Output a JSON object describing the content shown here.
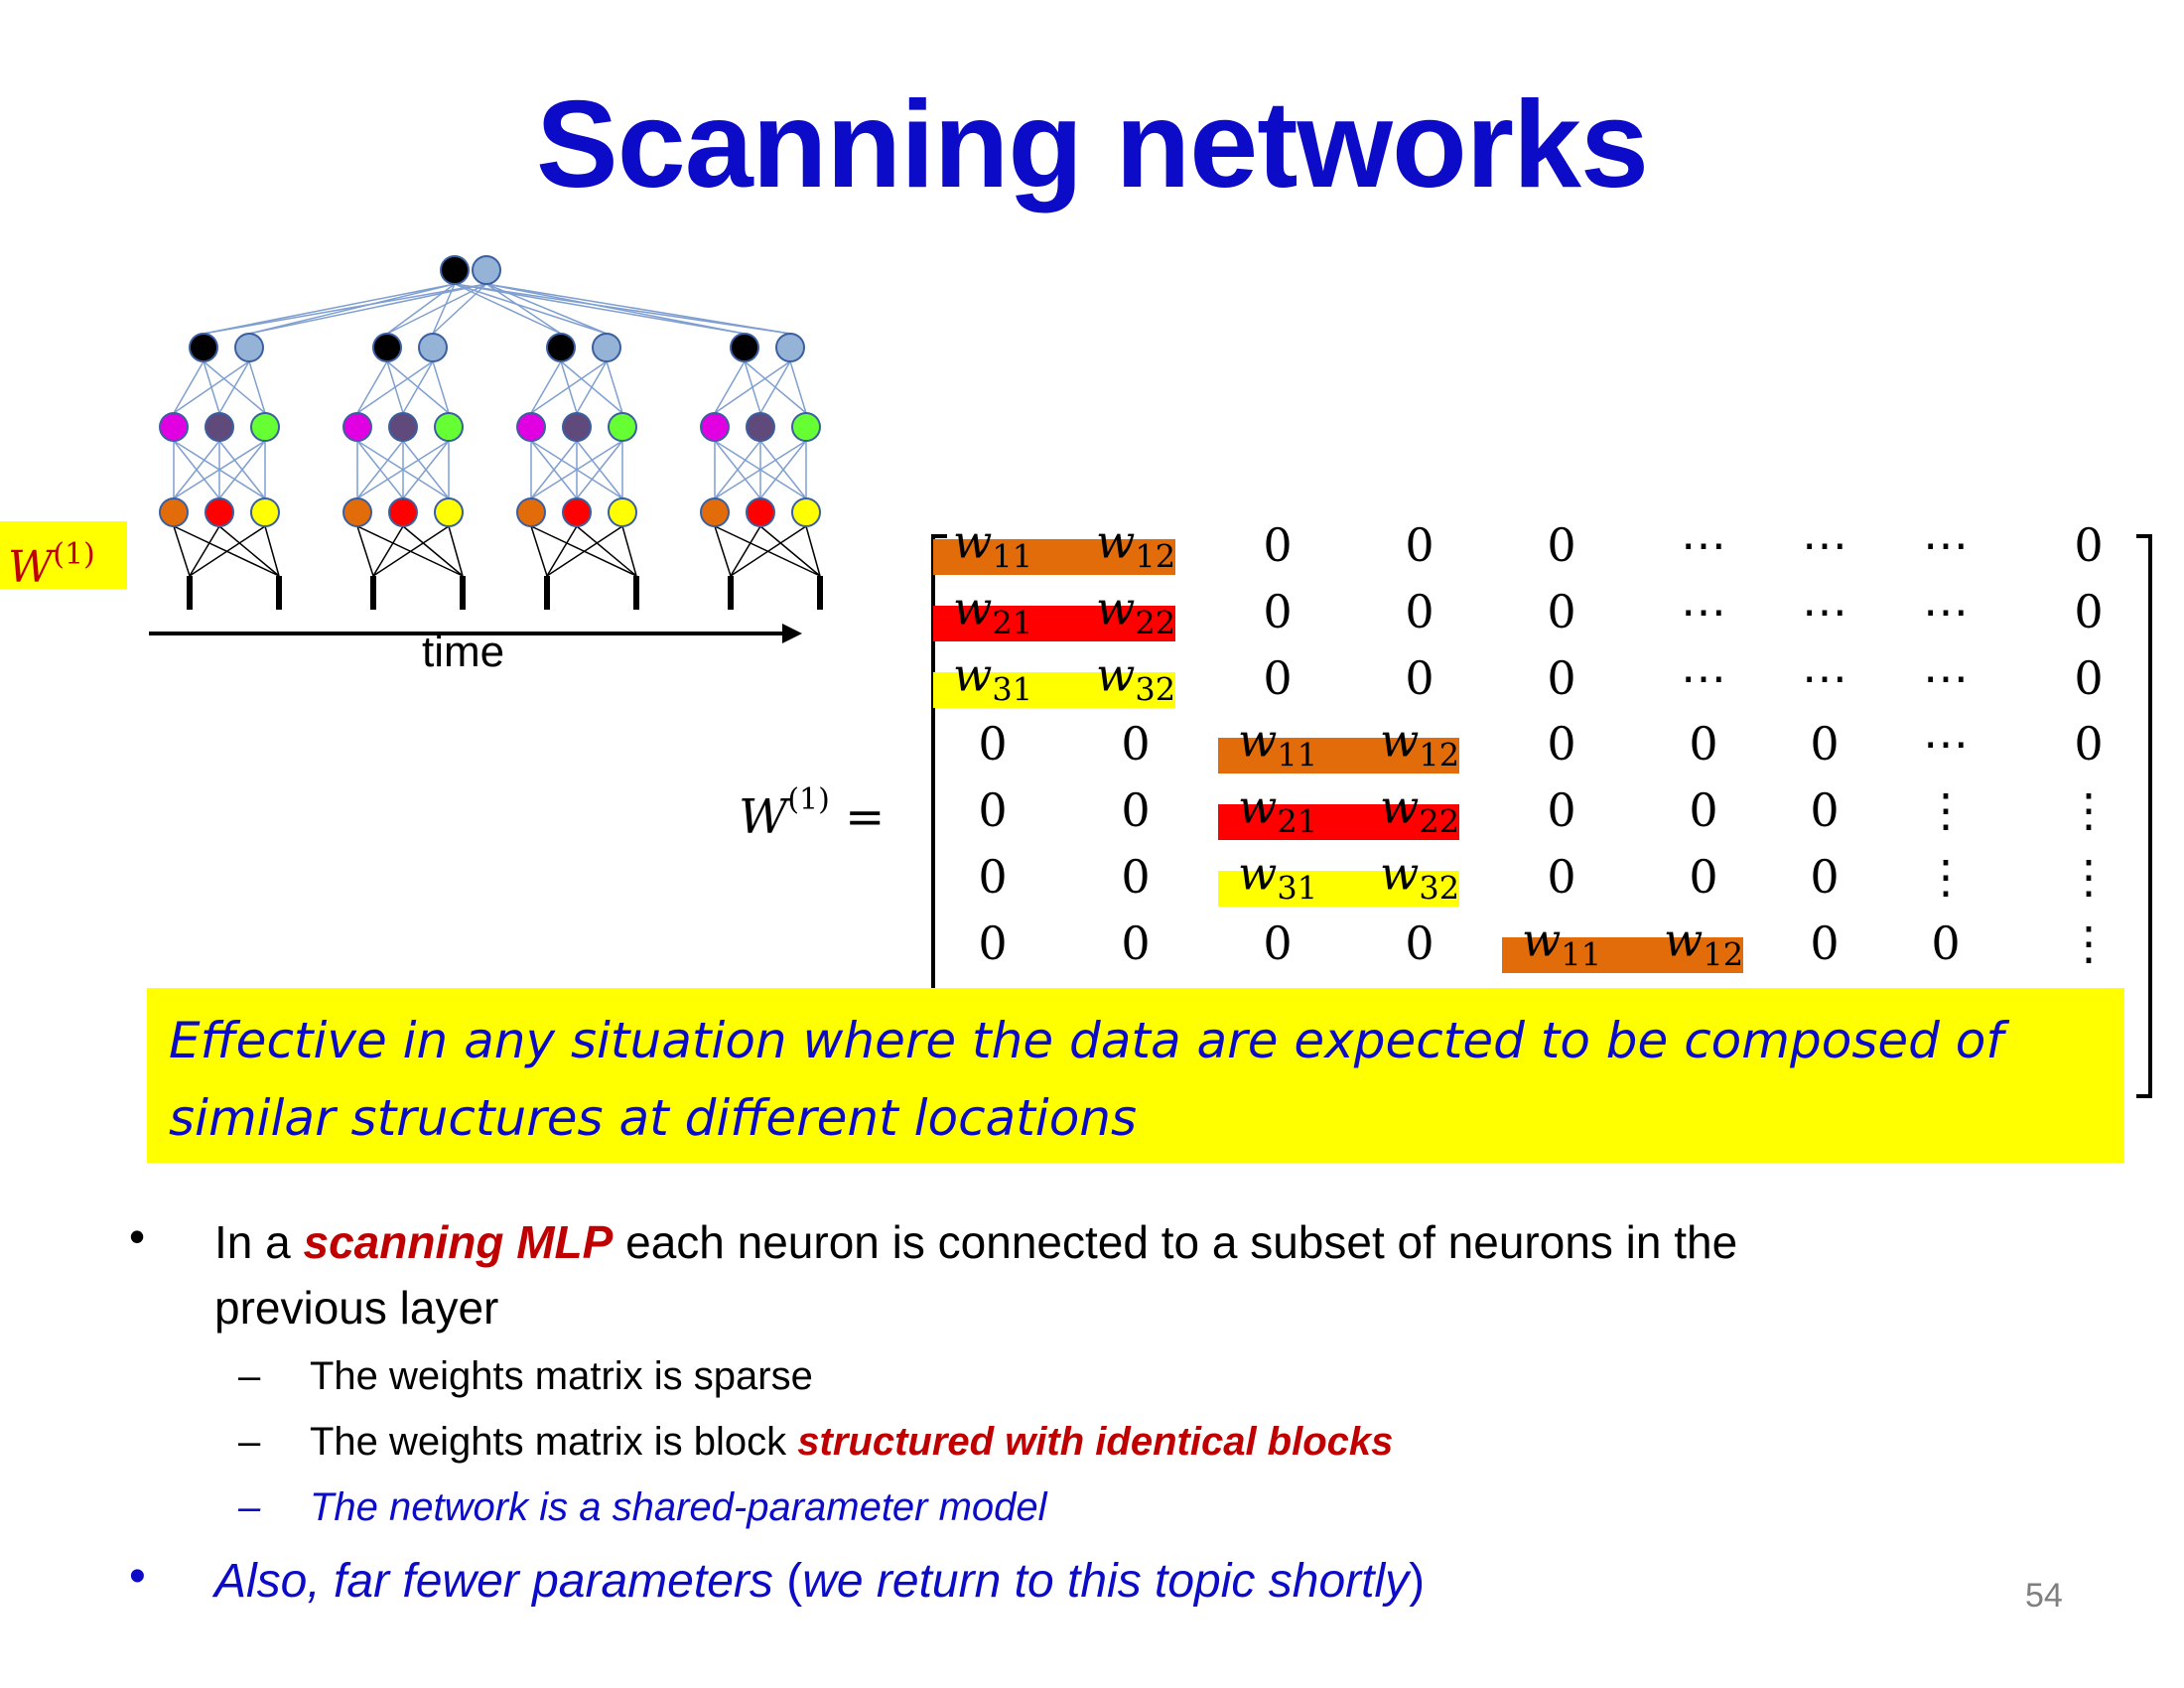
{
  "slide": {
    "title": "Scanning networks",
    "w_label_base": "W",
    "w_label_sup": "(1)",
    "time_label": "time",
    "matrix_lhs_base": "W",
    "matrix_lhs_sup": "(1)",
    "matrix_lhs_eq": "=",
    "callout_line1": "Effective in any situation where the data are expected to be composed of",
    "callout_line2": "similar structures at different locations",
    "bullet1_pre": "In a ",
    "bullet1_em": "scanning MLP",
    "bullet1_post": " each neuron is connected to a subset of neurons in the",
    "bullet1_line2": "previous layer",
    "sub1": "The weights matrix is sparse",
    "sub2_pre": "The weights matrix is block ",
    "sub2_em": "structured with identical blocks",
    "sub3": "The network is a shared-parameter model",
    "bullet2_a": "Also, far fewer parameters",
    "bullet2_b": " (",
    "bullet2_c": "we return to this topic shortly",
    "bullet2_d": ")",
    "bullet_glyph": "•",
    "dash_glyph": "–",
    "page_number": "54"
  },
  "colors": {
    "title": "#0b0bc8",
    "orange": "#e36c0a",
    "red": "#ff0000",
    "yellow": "#ffff00",
    "accent_red": "#c00000",
    "blue_text": "#0b0bc8",
    "node_black": "#000000",
    "node_lightblue": "#95b3d7",
    "node_magenta": "#e100e1",
    "node_purple": "#604a7b",
    "node_green": "#66ff33",
    "edge": "#7f9fd0"
  },
  "matrix": {
    "rows": [
      [
        "w11",
        "w12",
        "0",
        "0",
        "0",
        "⋯",
        "⋯",
        "⋯",
        "0"
      ],
      [
        "w21",
        "w22",
        "0",
        "0",
        "0",
        "⋯",
        "⋯",
        "⋯",
        "0"
      ],
      [
        "w31",
        "w32",
        "0",
        "0",
        "0",
        "⋯",
        "⋯",
        "⋯",
        "0"
      ],
      [
        "0",
        "0",
        "w11",
        "w12",
        "0",
        "0",
        "0",
        "⋯",
        "0"
      ],
      [
        "0",
        "0",
        "w21",
        "w22",
        "0",
        "0",
        "0",
        "⋮",
        "⋮"
      ],
      [
        "0",
        "0",
        "w31",
        "w32",
        "0",
        "0",
        "0",
        "⋮",
        "⋮"
      ],
      [
        "0",
        "0",
        "0",
        "0",
        "w11",
        "w12",
        "0",
        "0",
        "⋮"
      ]
    ]
  }
}
